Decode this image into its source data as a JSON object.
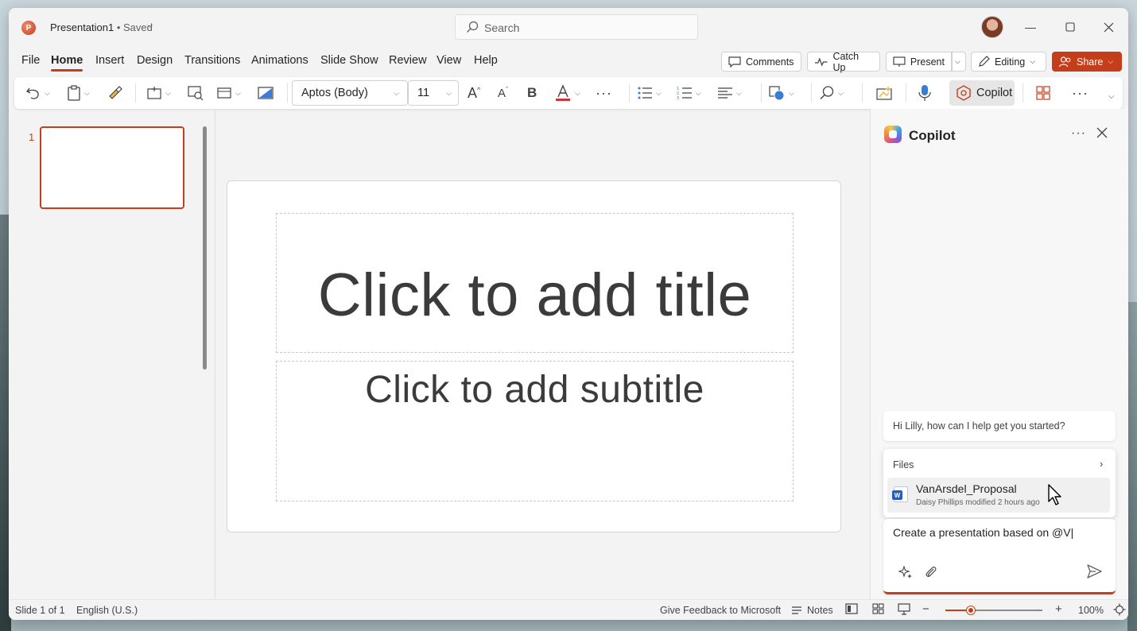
{
  "titlebar": {
    "app_logo": "P",
    "doc_name": "Presentation1",
    "doc_status": " • Saved",
    "search_placeholder": "Search"
  },
  "menu": {
    "tabs": [
      "File",
      "Home",
      "Insert",
      "Design",
      "Transitions",
      "Animations",
      "Slide Show",
      "Review",
      "View",
      "Help"
    ],
    "active": "Home",
    "comments": "Comments",
    "catch_up": "Catch Up",
    "present": "Present",
    "editing": "Editing",
    "share": "Share"
  },
  "ribbon": {
    "font_name": "Aptos (Body)",
    "font_size": "11",
    "copilot": "Copilot",
    "font_color": "#d13438"
  },
  "thumbnails": {
    "slide_number": "1"
  },
  "slide": {
    "title_placeholder": "Click to add title",
    "subtitle_placeholder": "Click to add subtitle"
  },
  "copilot": {
    "title": "Copilot",
    "greeting": "Hi Lilly, how can I help get you started?",
    "files_label": "Files",
    "file_name": "VanArsdel_Proposal",
    "file_meta": "Daisy Phillips modified 2 hours ago",
    "input_text": "Create a presentation based on @V"
  },
  "statusbar": {
    "slide_info": "Slide 1 of 1",
    "language": "English (U.S.)",
    "feedback": "Give Feedback to Microsoft",
    "notes": "Notes",
    "zoom": "100%"
  },
  "colors": {
    "accent": "#c43e1c",
    "background": "#f3f3f3"
  }
}
